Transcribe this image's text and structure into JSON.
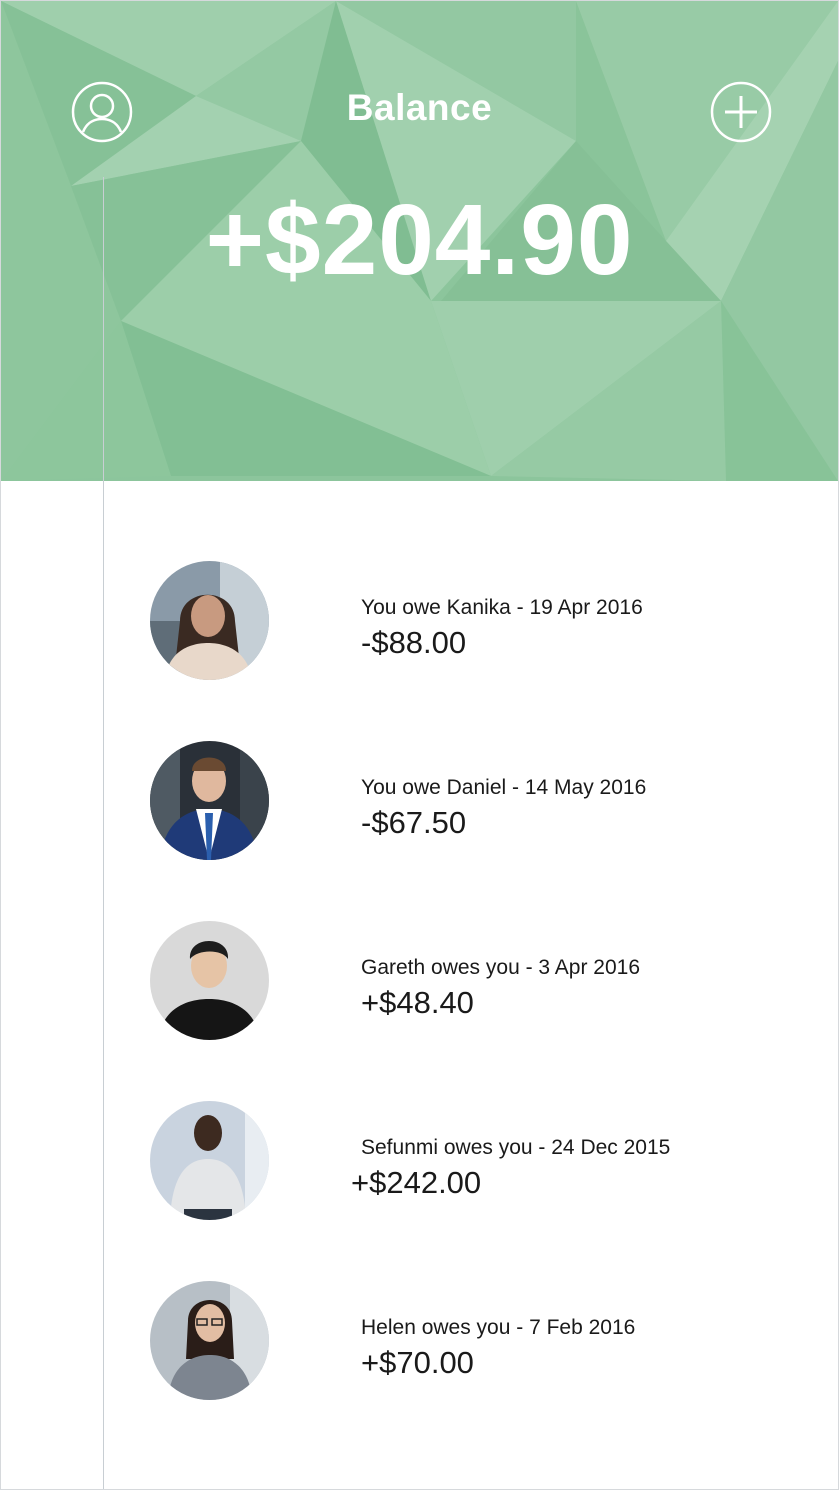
{
  "header": {
    "title": "Balance",
    "balance": "+$204.90",
    "profile_icon": "user-icon",
    "add_icon": "plus-icon"
  },
  "colors": {
    "header_green": "#8cc59c",
    "text": "#1a1a1a",
    "white": "#ffffff"
  },
  "transactions": [
    {
      "description": "You owe Kanika - 19 Apr 2016",
      "amount": "-$88.00",
      "avatar": "avatar-kanika"
    },
    {
      "description": "You owe Daniel - 14 May 2016",
      "amount": "-$67.50",
      "avatar": "avatar-daniel"
    },
    {
      "description": "Gareth owes you - 3 Apr 2016",
      "amount": "+$48.40",
      "avatar": "avatar-gareth"
    },
    {
      "description": "Sefunmi owes you - 24 Dec 2015",
      "amount": "+$242.00",
      "avatar": "avatar-sefunmi"
    },
    {
      "description": "Helen owes you - 7 Feb 2016",
      "amount": "+$70.00",
      "avatar": "avatar-helen"
    }
  ]
}
